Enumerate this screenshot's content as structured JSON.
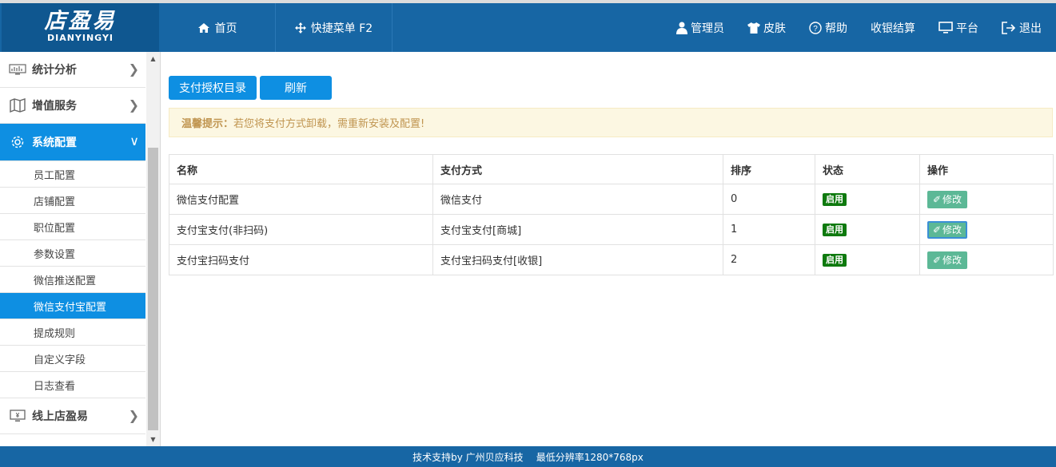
{
  "logo": {
    "cn": "店盈易",
    "en": "DIANYINGYI"
  },
  "nav_left": [
    {
      "label": "首页",
      "icon": "home-icon"
    },
    {
      "label": "快捷菜单 F2",
      "icon": "move-icon"
    }
  ],
  "nav_right": [
    {
      "label": "管理员",
      "icon": "user-icon"
    },
    {
      "label": "皮肤",
      "icon": "shirt-icon"
    },
    {
      "label": "帮助",
      "icon": "help-icon"
    },
    {
      "label": "收银结算",
      "icon": ""
    },
    {
      "label": "平台",
      "icon": "monitor-icon"
    },
    {
      "label": "退出",
      "icon": "logout-icon"
    }
  ],
  "sidebar": {
    "groups": [
      {
        "label": "统计分析",
        "icon": "chart-icon"
      },
      {
        "label": "增值服务",
        "icon": "map-icon"
      },
      {
        "label": "系统配置",
        "icon": "gear-icon"
      }
    ],
    "subitems": [
      "员工配置",
      "店铺配置",
      "职位配置",
      "参数设置",
      "微信推送配置",
      "微信支付宝配置",
      "提成规则",
      "自定义字段",
      "日志查看"
    ],
    "active_sub": "微信支付宝配置",
    "bottom_group": {
      "label": "线上店盈易",
      "icon": "yen-monitor-icon"
    }
  },
  "toolbar": {
    "catalog_label": "支付授权目录",
    "refresh_label": "刷新"
  },
  "notice": {
    "title": "温馨提示：",
    "text": "若您将支付方式卸载，需重新安装及配置!"
  },
  "table": {
    "headers": [
      "名称",
      "支付方式",
      "排序",
      "状态",
      "操作"
    ],
    "rows": [
      {
        "name": "微信支付配置",
        "method": "微信支付",
        "sort": "0",
        "status": "启用",
        "action": "修改"
      },
      {
        "name": "支付宝支付(非扫码)",
        "method": "支付宝支付[商城]",
        "sort": "1",
        "status": "启用",
        "action": "修改"
      },
      {
        "name": "支付宝扫码支付",
        "method": "支付宝扫码支付[收银]",
        "sort": "2",
        "status": "启用",
        "action": "修改"
      }
    ]
  },
  "footer": {
    "support": "技术支持by 广州贝应科技",
    "resolution": "最低分辨率1280*768px"
  }
}
